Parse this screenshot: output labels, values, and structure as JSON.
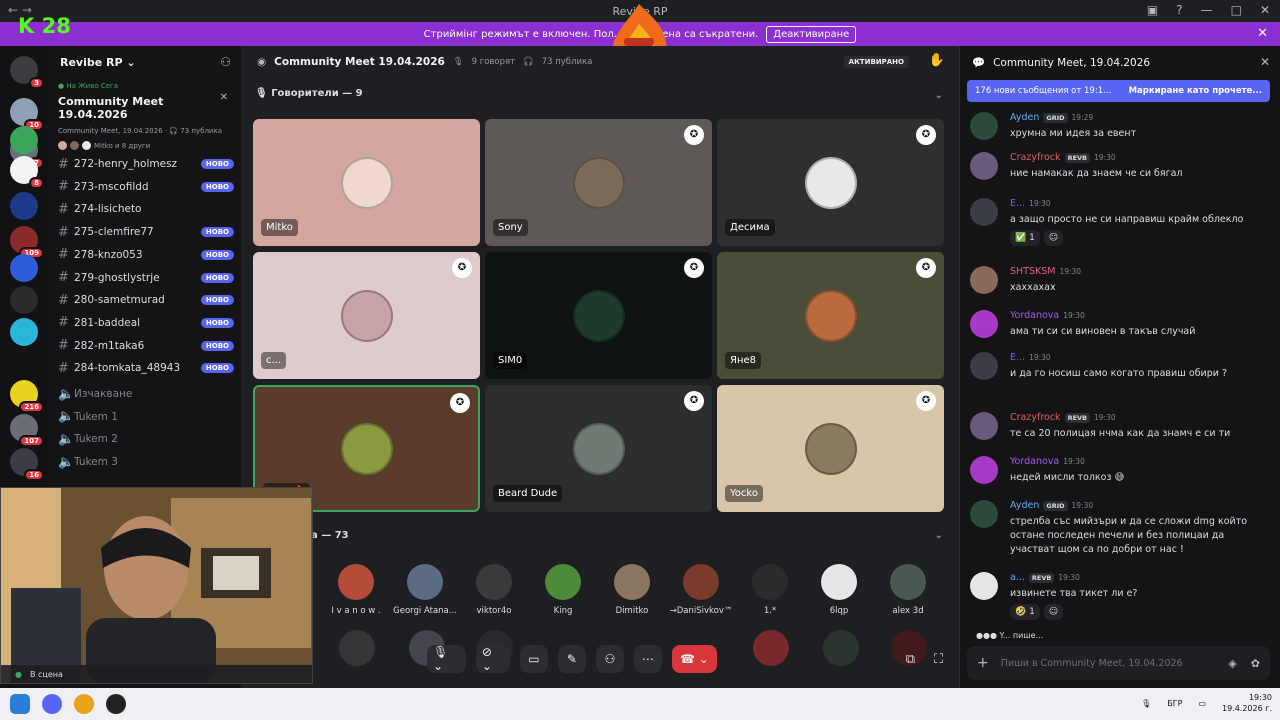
{
  "titlebar": {
    "title": "Revibe RP"
  },
  "banner": {
    "text": "Стриймінг режимът е включен. Пол... ите имена са съкратени.",
    "button": "Деактивиране"
  },
  "brand": "K 28",
  "server_badges": [
    "10",
    "3",
    "7",
    "",
    "8",
    "",
    "109",
    "",
    "",
    "",
    "216",
    "107",
    "16"
  ],
  "server": {
    "name": "Revibe RP"
  },
  "live": {
    "label": "На Живо Сега",
    "title": "Community Meet 19.04.2026",
    "sub": "Community Meet, 19.04.2026 · 🎧 73 публика",
    "members": "Mitko и 8 други"
  },
  "channels": [
    {
      "name": "272-henry_holmesz",
      "novo": "НОВО"
    },
    {
      "name": "273-mscofildd",
      "novo": "НОВО"
    },
    {
      "name": "274-lisicheto",
      "novo": ""
    },
    {
      "name": "275-clemfire77",
      "novo": "НОВО"
    },
    {
      "name": "278-knzo053",
      "novo": "НОВО"
    },
    {
      "name": "279-ghostlystrje",
      "novo": "НОВО"
    },
    {
      "name": "280-sametmurad",
      "novo": "НОВО"
    },
    {
      "name": "281-baddeal",
      "novo": "НОВО"
    },
    {
      "name": "282-m1taka6",
      "novo": "НОВО"
    },
    {
      "name": "284-tomkata_48943",
      "novo": "НОВО"
    }
  ],
  "voice_channels": [
    "Изчакване",
    "Tukem 1",
    "Tukem 2",
    "Tukem 3"
  ],
  "stage": {
    "title": "Community Meet 19.04.2026",
    "speaking": "9 говорят",
    "audience": "73 публика",
    "status": "АКТИВИРАНО",
    "speakers_header": "Говорители — 9",
    "audience_header": "а — 73"
  },
  "speakers": [
    {
      "name": "Mitko",
      "bg": "#d3a6a0",
      "av": "#f0d8cf",
      "mod": false
    },
    {
      "name": "Sony",
      "bg": "#5e5856",
      "av": "#7b6b59",
      "mod": true
    },
    {
      "name": "Десима",
      "bg": "#2f2f31",
      "av": "#e8e8ea",
      "mod": true
    },
    {
      "name": "c...",
      "bg": "#e0cbcc",
      "av": "#c9a3a8",
      "mod": true
    },
    {
      "name": "SIM0",
      "bg": "#0e1210",
      "av": "#1d3a2a",
      "mod": true
    },
    {
      "name": "Яне8",
      "bg": "#4a4d37",
      "av": "#b86a3e",
      "mod": true
    },
    {
      "name": "...ov 🔥",
      "bg": "#5a3b2c",
      "av": "#8a9a3e",
      "mod": true
    },
    {
      "name": "Beard Dude",
      "bg": "#2c2d2f",
      "av": "#6f7a72",
      "mod": true
    },
    {
      "name": "Yocko",
      "bg": "#d9c5a7",
      "av": "#8a7a60",
      "mod": true
    }
  ],
  "audience": [
    {
      "name": "I v a n o w .",
      "color": "#b44a3a"
    },
    {
      "name": "Georgi Atana...",
      "color": "#5a6b82"
    },
    {
      "name": "viktor4o",
      "color": "#3a3a3c"
    },
    {
      "name": "King",
      "color": "#4d8a3a"
    },
    {
      "name": "Dimitko",
      "color": "#8a7660"
    },
    {
      "name": "→DaniSivkov™",
      "color": "#7a3a2c"
    },
    {
      "name": "1.*",
      "color": "#2b2b2d"
    },
    {
      "name": "6lqp",
      "color": "#e6e6e8"
    },
    {
      "name": "alex 3d",
      "color": "#4a5a52"
    }
  ],
  "chat": {
    "title": "Community Meet, 19.04.2026",
    "new_messages": "176 нови съобщения от 19:1...",
    "mark_read": "Маркиране като прочете...",
    "typing": "Y... пише...",
    "placeholder": "Пиши в Community Meet, 19.04.2026",
    "messages": [
      {
        "author": "Ayden",
        "color": "#5dadec",
        "tag": "GRID",
        "time": "19:29",
        "text": "хрумна ми идея за евент",
        "av": "#2c4a3a",
        "reactions": []
      },
      {
        "author": "Crazyfrock",
        "color": "#e35d5d",
        "tag": "REVB",
        "time": "19:30",
        "text": "ние намакак да знаем че си бягал",
        "av": "#6a5a7a",
        "reactions": []
      },
      {
        "author": "E...",
        "color": "#5865f2",
        "tag": "",
        "time": "19:30",
        "text": "а защо просто не си направиш крайм облекло",
        "av": "#3a3d45",
        "reactions": [
          "✅ 1",
          "☺"
        ]
      },
      {
        "author": "SHTSKSM",
        "color": "#e35d8a",
        "tag": "",
        "time": "19:30",
        "text": "хаххахах",
        "av": "#8a6a5a",
        "reactions": []
      },
      {
        "author": "Yordanova",
        "color": "#a55de3",
        "tag": "",
        "time": "19:30",
        "text": "ама ти си си виновен в такъв случай",
        "av": "#a63ac4",
        "reactions": []
      },
      {
        "author": "E...",
        "color": "#5865f2",
        "tag": "",
        "time": "19:30",
        "text": "и да го носиш само когато правиш обири ?",
        "av": "#3a3d45",
        "reactions": []
      },
      {
        "author": "Crazyfrock",
        "color": "#e35d5d",
        "tag": "REVB",
        "time": "19:30",
        "text": "те са 20 полицая нчма как да знамч е си ти",
        "av": "#6a5a7a",
        "reactions": []
      },
      {
        "author": "Yordanova",
        "color": "#a55de3",
        "tag": "",
        "time": "19:30",
        "text": "недей мисли толкоз 😅",
        "av": "#a63ac4",
        "reactions": []
      },
      {
        "author": "Ayden",
        "color": "#5dadec",
        "tag": "GRID",
        "time": "19:30",
        "text": "стрелба със мийзъри и да се сложи dmg който остане последен печели и без полицаи да участват щом са по добри от нас !",
        "av": "#2c4a3a",
        "reactions": []
      },
      {
        "author": "a...",
        "color": "#5dadec",
        "tag": "REVB",
        "time": "19:30",
        "text": "извинете тва тикет ли е?",
        "av": "#e6e6e8",
        "reactions": [
          "🤣 1",
          "☺"
        ]
      }
    ]
  },
  "webcam": {
    "label": "В сцена"
  },
  "taskbar": {
    "lang": "БГР",
    "time": "19:30",
    "date": "19.4.2026 г."
  }
}
